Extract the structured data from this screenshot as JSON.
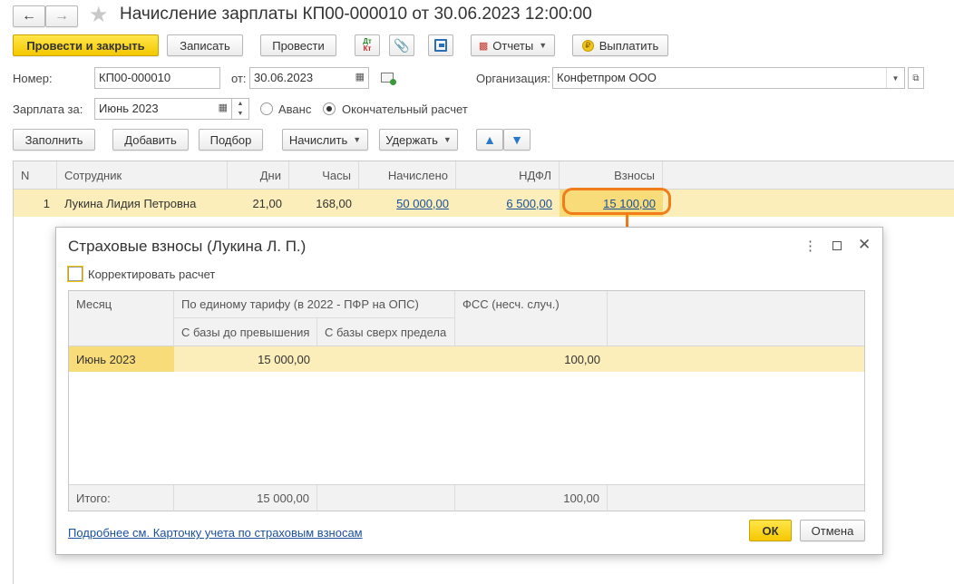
{
  "window": {
    "title": "Начисление зарплаты КП00-000010 от 30.06.2023 12:00:00"
  },
  "toolbar": {
    "post_close": "Провести и закрыть",
    "save": "Записать",
    "post": "Провести",
    "reports": "Отчеты",
    "pay": "Выплатить",
    "dt_kt": "Дт Кт"
  },
  "form": {
    "number_label": "Номер:",
    "number_value": "КП00-000010",
    "date_label": "от:",
    "date_value": "30.06.2023",
    "org_label": "Организация:",
    "org_value": "Конфетпром ООО",
    "salary_for_label": "Зарплата за:",
    "salary_for_value": "Июнь 2023",
    "advance_label": "Аванс",
    "final_label": "Окончательный расчет"
  },
  "actions": {
    "fill": "Заполнить",
    "add": "Добавить",
    "select": "Подбор",
    "accrue": "Начислить",
    "withhold": "Удержать"
  },
  "table": {
    "headers": [
      "N",
      "Сотрудник",
      "Дни",
      "Часы",
      "Начислено",
      "НДФЛ",
      "Взносы"
    ],
    "rows": [
      {
        "n": "1",
        "employee": "Лукина Лидия Петровна",
        "days": "21,00",
        "hours": "168,00",
        "accrued": "50 000,00",
        "ndfl": "6 500,00",
        "contrib": "15 100,00"
      }
    ]
  },
  "dialog": {
    "title": "Страховые взносы (Лукина Л. П.)",
    "adjust_label": "Корректировать расчет",
    "col_month": "Месяц",
    "col_group": "По единому тарифу (в 2022 - ПФР на ОПС)",
    "col_base_below": "С базы до превышения",
    "col_base_above": "С базы сверх предела",
    "col_fss": "ФСС (несч. случ.)",
    "rows": [
      {
        "month": "Июнь 2023",
        "below": "15 000,00",
        "above": "",
        "fss": "100,00"
      }
    ],
    "total_label": "Итого:",
    "total_below": "15 000,00",
    "total_fss": "100,00",
    "link": "Подробнее см. Карточку учета по страховым взносам",
    "ok": "ОК",
    "cancel": "Отмена"
  },
  "colors": {
    "accent_yellow": "#f5c800",
    "row_highlight": "#fbeeba",
    "callout_orange": "#f07d1a",
    "link_blue": "#1a4f9c"
  }
}
